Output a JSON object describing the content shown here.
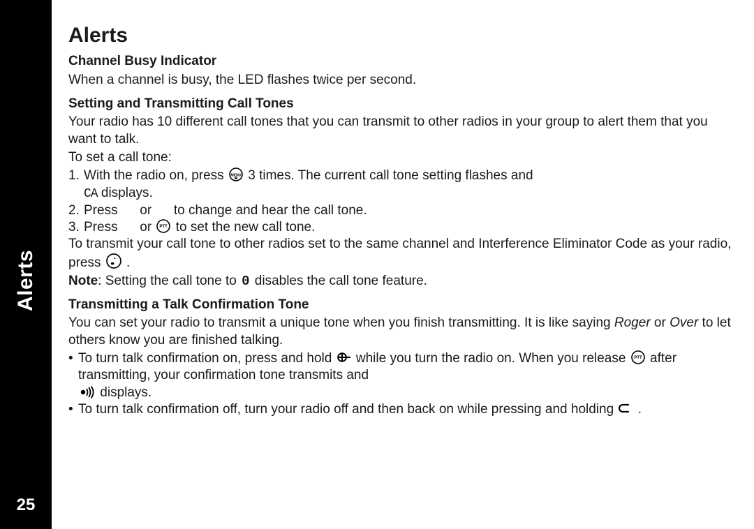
{
  "sidebar": {
    "title": "Alerts",
    "page_number": "25"
  },
  "main": {
    "title": "Alerts",
    "s1": {
      "heading": "Channel Busy Indicator",
      "p1": "When a channel is busy, the LED flashes twice per second."
    },
    "s2": {
      "heading": "Setting and Transmitting Call Tones",
      "p1": "Your radio has 10 different call tones that you can transmit to other radios in your group to alert them that you want to talk.",
      "p2": "To set a call tone:",
      "step1_a": "With the radio on, press ",
      "step1_b": " 3 times. The current call tone setting flashes and ",
      "step1_c": " displays.",
      "step2_a": "Press ",
      "step2_or": " or ",
      "step2_b": " to change and hear the call tone.",
      "step3_a": "Press ",
      "step3_or": " or ",
      "step3_b": " to set the new call tone.",
      "p3a": "To transmit your call tone to other radios set to the same channel and Interference Eliminator Code as your radio, press ",
      "p3b": " .",
      "note_label": "Note",
      "note_a": ": Setting the call tone to ",
      "note_b": " disables the call tone feature.",
      "zero_glyph": "0",
      "ca_glyph": "CA"
    },
    "s3": {
      "heading": "Transmitting a Talk Confirmation Tone",
      "p1a": "You can set your radio to transmit a unique tone when you finish transmitting. It is like saying ",
      "p1b": " or ",
      "p1c": " to let others know you are finished talking.",
      "roger": "Roger",
      "over": "Over",
      "b1a": "To turn talk confirmation on, press and hold ",
      "b1b": " while you turn the radio on. When you release ",
      "b1c": " after transmitting, your confirmation tone transmits and ",
      "b1d": " displays.",
      "b2a": "To turn talk confirmation off, turn your radio off and then back on while pressing and holding ",
      "b2b": " ."
    },
    "nums": {
      "n1": "1.",
      "n2": "2.",
      "n3": "3."
    },
    "bullet": "•"
  }
}
